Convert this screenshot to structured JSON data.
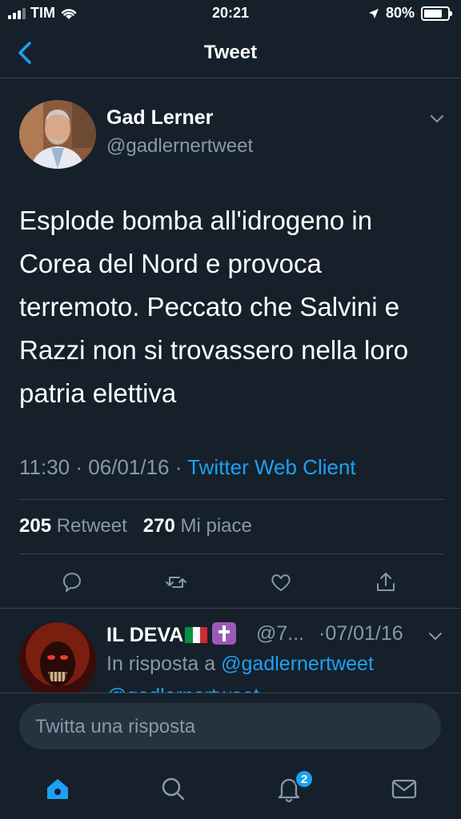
{
  "status_bar": {
    "carrier": "TIM",
    "time": "20:21",
    "battery_percent": "80%",
    "battery_level": 0.8
  },
  "nav": {
    "title": "Tweet",
    "back_icon": "chevron-left-icon"
  },
  "tweet": {
    "author_name": "Gad Lerner",
    "author_handle": "@gadlernertweet",
    "text": "Esplode bomba all'idrogeno in Corea del Nord e provoca terremoto. Peccato che Salvini e Razzi non si trovassero nella loro patria elettiva",
    "time": "11:30",
    "separator": "·",
    "date": "06/01/16",
    "client": "Twitter Web Client",
    "retweet_count": "205",
    "retweet_label": "Retweet",
    "like_count": "270",
    "like_label": "Mi piace"
  },
  "reply": {
    "name": "IL DEVA",
    "handle": "@7...",
    "date": "·07/01/16",
    "context_prefix": "In risposta a",
    "context_mention": "@gadlernertweet",
    "next_line_partial": "@gadlernertweet",
    "flag_colors": [
      "#009246",
      "#ffffff",
      "#ce2b37"
    ]
  },
  "compose": {
    "placeholder": "Twitta una risposta"
  },
  "tabbar": {
    "notifications_badge": "2"
  },
  "colors": {
    "background": "#15202b",
    "accent": "#1da1f2",
    "muted": "#8899a6",
    "divider": "#38444d"
  }
}
